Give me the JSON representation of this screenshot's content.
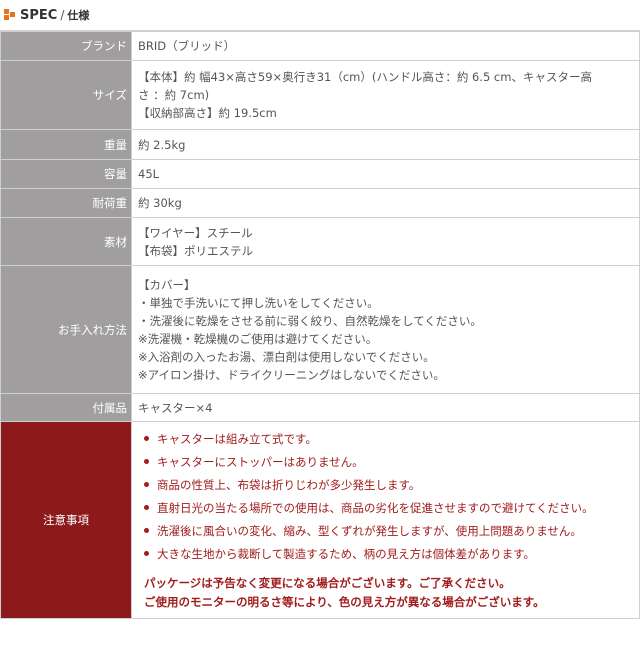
{
  "header": {
    "title": "SPEC",
    "separator": "/",
    "subtitle": "仕様"
  },
  "rows": [
    {
      "label": "ブランド",
      "lines": [
        "BRID（ブリッド）"
      ]
    },
    {
      "label": "サイズ",
      "lines": [
        "【本体】約 幅43×高さ59×奥行き31（cm）(ハンドル高さ：約 6.5 cm、キャスター高",
        "さ ：約 7cm)",
        "【収納部高さ】約 19.5cm"
      ]
    },
    {
      "label": "重量",
      "lines": [
        "約 2.5kg"
      ]
    },
    {
      "label": "容量",
      "lines": [
        "45L"
      ]
    },
    {
      "label": "耐荷重",
      "lines": [
        "約 30kg"
      ]
    },
    {
      "label": "素材",
      "lines": [
        "【ワイヤー】スチール",
        "【布袋】ポリエステル"
      ]
    },
    {
      "label": "お手入れ方法",
      "lines": [
        "【カバー】",
        "・単独で手洗いにて押し洗いをしてください。",
        "・洗濯後に乾燥をさせる前に弱く絞り、自然乾燥をしてください。",
        "※洗濯機・乾燥機のご使用は避けてください。",
        "※入浴剤の入ったお湯、漂白剤は使用しないでください。",
        "※アイロン掛け、ドライクリーニングはしないでください。"
      ]
    },
    {
      "label": "付属品",
      "lines": [
        "キャスター×4"
      ]
    }
  ],
  "warning": {
    "label": "注意事項",
    "bullets": [
      "キャスターは組み立て式です。",
      "キャスターにストッパーはありません。",
      "商品の性質上、布袋は折りじわが多少発生します。",
      "直射日光の当たる場所での使用は、商品の劣化を促進させますので避けてください。",
      "洗濯後に風合いの変化、縮み、型くずれが発生しますが、使用上問題ありません。",
      "大きな生地から裁断して製造するため、柄の見え方は個体差があります。"
    ],
    "notices": [
      "パッケージは予告なく変更になる場合がございます。ご了承ください。",
      "ご使用のモニターの明るさ等により、色の見え方が異なる場合がございます。"
    ]
  },
  "colors": {
    "label_bg": "#a09e9e",
    "warning_bg": "#8c1a1a",
    "accent": "#e8731c",
    "warning_text": "#a11d1d"
  }
}
